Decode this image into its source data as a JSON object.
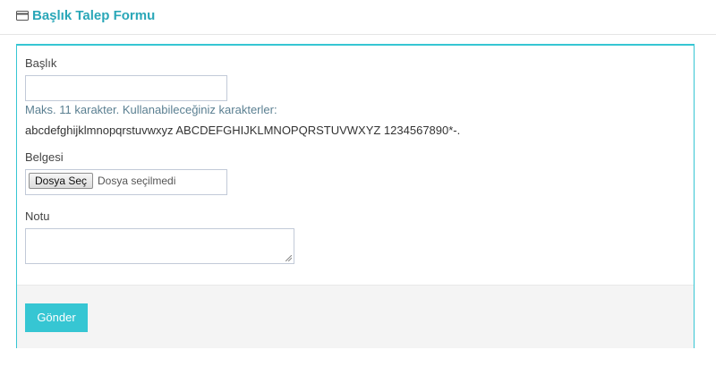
{
  "header": {
    "icon": "credit-card-icon",
    "title": "Başlık Talep Formu"
  },
  "form": {
    "title_label": "Başlık",
    "title_value": "",
    "help_text": "Maks. 11 karakter. Kullanabileceğiniz karakterler:",
    "allowed_chars": "abcdefghijklmnopqrstuvwxyz ABCDEFGHIJKLMNOPQRSTUVWXYZ 1234567890*-.",
    "document_label": "Belgesi",
    "file_button": "Dosya Seç",
    "file_status": "Dosya seçilmedi",
    "note_label": "Notu",
    "note_value": "",
    "submit": "Gönder"
  },
  "colors": {
    "accent": "#36c6d3",
    "title": "#2aa7b8",
    "help": "#5a7f91"
  }
}
